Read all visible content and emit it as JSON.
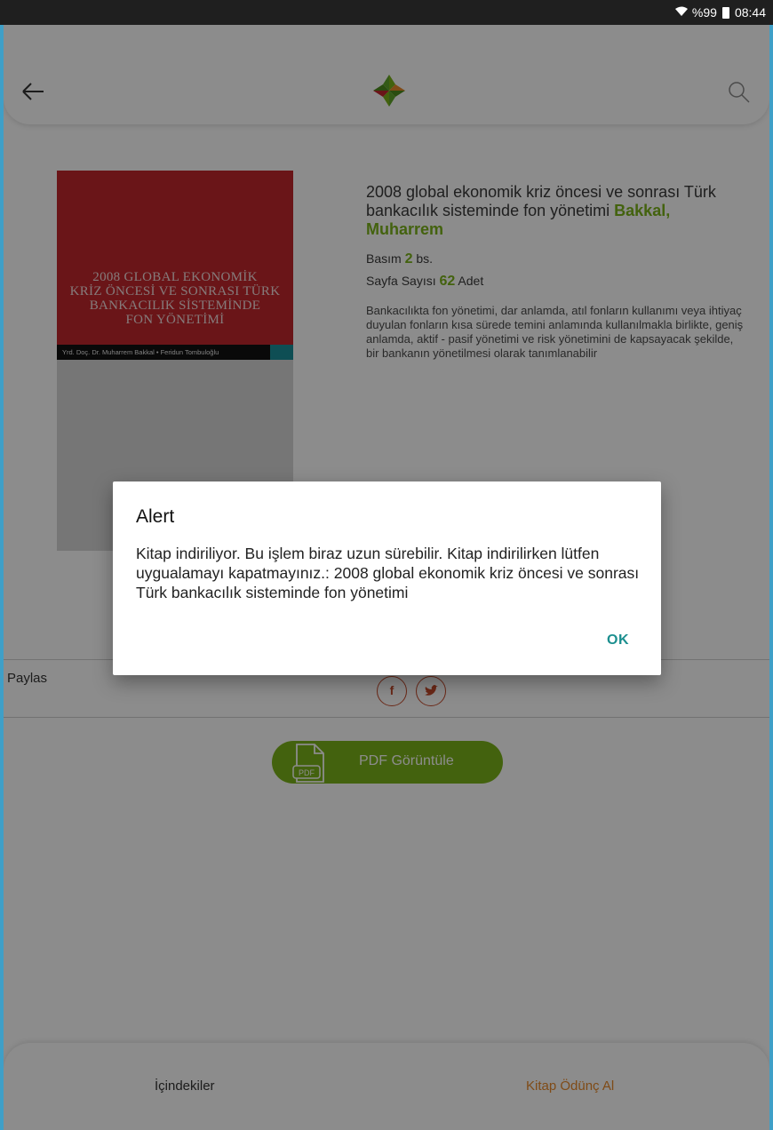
{
  "status_bar": {
    "battery": "%99",
    "time": "08:44"
  },
  "toolbar": {
    "back_icon": "arrow-left-icon",
    "logo_icon": "app-logo-icon",
    "search_icon": "search-icon"
  },
  "cover": {
    "title_lines": [
      "2008 GLOBAL EKONOMİK",
      "KRİZ ÖNCESİ VE SONRASI TÜRK",
      "BANKACILIK SİSTEMİNDE",
      "FON YÖNETİMİ"
    ],
    "authors": "Yrd. Doç. Dr. Muharrem Bakkal • Feridun Tombuloğlu"
  },
  "book": {
    "title": "2008 global ekonomik kriz öncesi ve sonrası Türk bankacılık sisteminde fon yönetimi",
    "author": "Bakkal, Muharrem",
    "edition_label": "Basım",
    "edition_value": "2",
    "edition_unit": "bs.",
    "pages_label": "Sayfa Sayısı",
    "pages_value": "62",
    "pages_unit": "Adet",
    "description": "Bankacılıkta fon yönetimi, dar anlamda, atıl fonların kullanımı veya ihtiyaç duyulan fonların kısa sürede temini anlamında kullanılmakla birlikte, geniş anlamda, aktif - pasif yönetimi ve risk yönetimini de kapsayacak şekilde, bir bankanın yönetilmesi olarak tanımlanabilir"
  },
  "share": {
    "label": "Paylas",
    "facebook": "f"
  },
  "pdf_button": {
    "label": "PDF Görüntüle",
    "icon_text": "PDF"
  },
  "bottom_nav": {
    "contents": "İçindekiler",
    "borrow": "Kitap Ödünç Al"
  },
  "dialog": {
    "title": "Alert",
    "message": "Kitap indiriliyor. Bu işlem biraz uzun sürebilir. Kitap indirilirken lütfen uygualamayı kapatmayınız.:  2008 global ekonomik kriz öncesi ve sonrası Türk bankacılık sisteminde fon yönetimi",
    "ok": "OK"
  },
  "colors": {
    "accent_green": "#7bb31a",
    "cover_red": "#c1272d",
    "dialog_button": "#1c8f8f",
    "borrow_orange": "#e8892b"
  }
}
